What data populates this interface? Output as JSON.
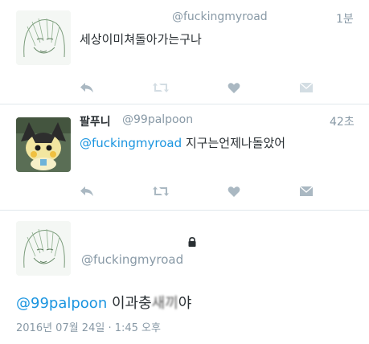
{
  "tweets": [
    {
      "handle": "@fuckingmyroad",
      "time": "1분",
      "text": "세상이미쳐돌아가는구나",
      "avatar_icon": "sketch-avatar-icon"
    },
    {
      "name": "팔푸니",
      "handle": "@99palpoon",
      "time": "42초",
      "mention": "@fuckingmyroad",
      "text": " 지구는언제나돌았어",
      "avatar_icon": "emolga-avatar-icon"
    }
  ],
  "main_tweet": {
    "handle": "@fuckingmyroad",
    "mention": "@99palpoon",
    "text_clear": " 이과충",
    "text_blurred": "새끼",
    "text_end": "야",
    "timestamp": "2016년 07월 24일 · 1:45 오후",
    "protected_icon": "lock-icon"
  },
  "action_icons": [
    "reply-icon",
    "retweet-icon",
    "like-icon",
    "dm-icon"
  ],
  "colors": {
    "link": "#1b95e0",
    "muted": "#8899a6",
    "icon": "#aab8c2",
    "border": "#e1e8ed"
  }
}
